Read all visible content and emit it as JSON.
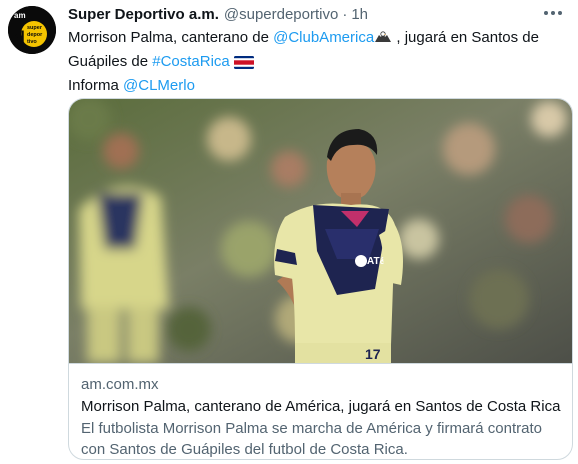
{
  "tweet": {
    "avatar": {
      "line1": "am",
      "line2": "super",
      "line3": "depor",
      "line4": "tivo",
      "letter": "d"
    },
    "display_name": "Super Deportivo a.m.",
    "handle": "@superdeportivo",
    "separator": "·",
    "time": "1h",
    "text": {
      "part1": "Morrison Palma, canterano de ",
      "mention_club": "@ClubAmerica",
      "part2": " , jugará en Santos de Guápiles de ",
      "hashtag": "#CostaRica",
      "part3": "Informa ",
      "mention_source": "@CLMerlo"
    },
    "icons": {
      "eagle": "eagle-emoji-icon",
      "flag": "costa-rica-flag-icon",
      "more": "more-icon"
    }
  },
  "card": {
    "domain": "am.com.mx",
    "title": "Morrison Palma, canterano de América, jugará en Santos de Costa Rica",
    "description": "El futbolista Morrison Palma se marcha de América y firmará contrato con Santos de Guápiles del futbol de Costa Rica.",
    "jersey_sponsor": "AT&T",
    "jersey_number": "17"
  },
  "colors": {
    "link": "#1d9bf0",
    "secondary": "#536471",
    "border": "#cfd9de",
    "avatar_accent": "#f5c400",
    "jersey_yellow": "#e8e6a8",
    "jersey_navy": "#1e2450"
  }
}
